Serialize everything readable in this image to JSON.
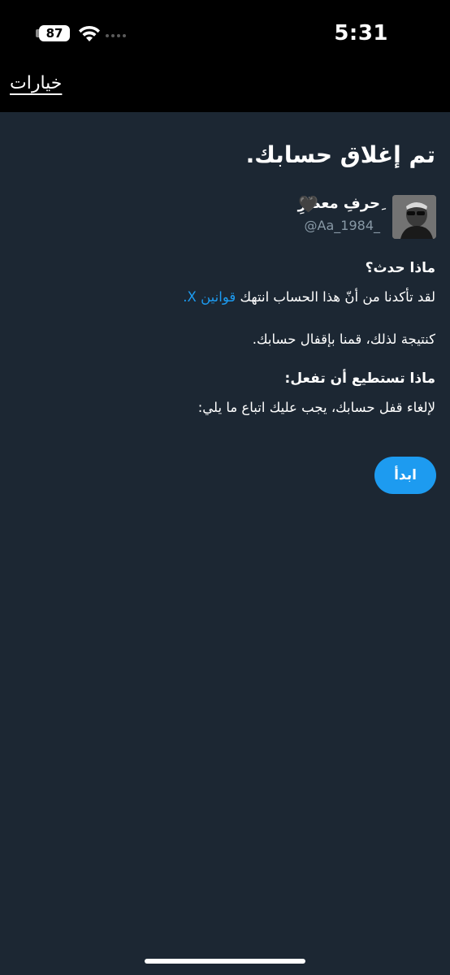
{
  "status_bar": {
    "battery": "87",
    "time": "5:31",
    "icons": [
      "battery-icon",
      "wifi-icon",
      "signal-icon"
    ]
  },
  "nav": {
    "options_label": "خيارات"
  },
  "main": {
    "title": "تم إغلاق حسابك.",
    "user": {
      "display_name": "ِحرفِ معطرِ",
      "heart": "🖤",
      "handle": "@Aa_1984_"
    },
    "what_happened_heading": "ماذا حدث؟",
    "what_happened_text": "لقد تأكدنا من أنّ هذا الحساب انتهك",
    "rules_link": "قوانين X.",
    "result_text": "كنتيجة لذلك، قمنا بإقفال حسابك.",
    "what_to_do_heading": "ماذا تستطيع أن تفعل:",
    "what_to_do_text": "لإلغاء قفل حسابك، يجب عليك اتباع ما يلي:",
    "start_button": "ابدأ"
  },
  "colors": {
    "background": "#1c2733",
    "bars": "#000000",
    "accent": "#1d9bf0",
    "muted": "#8899a6"
  }
}
